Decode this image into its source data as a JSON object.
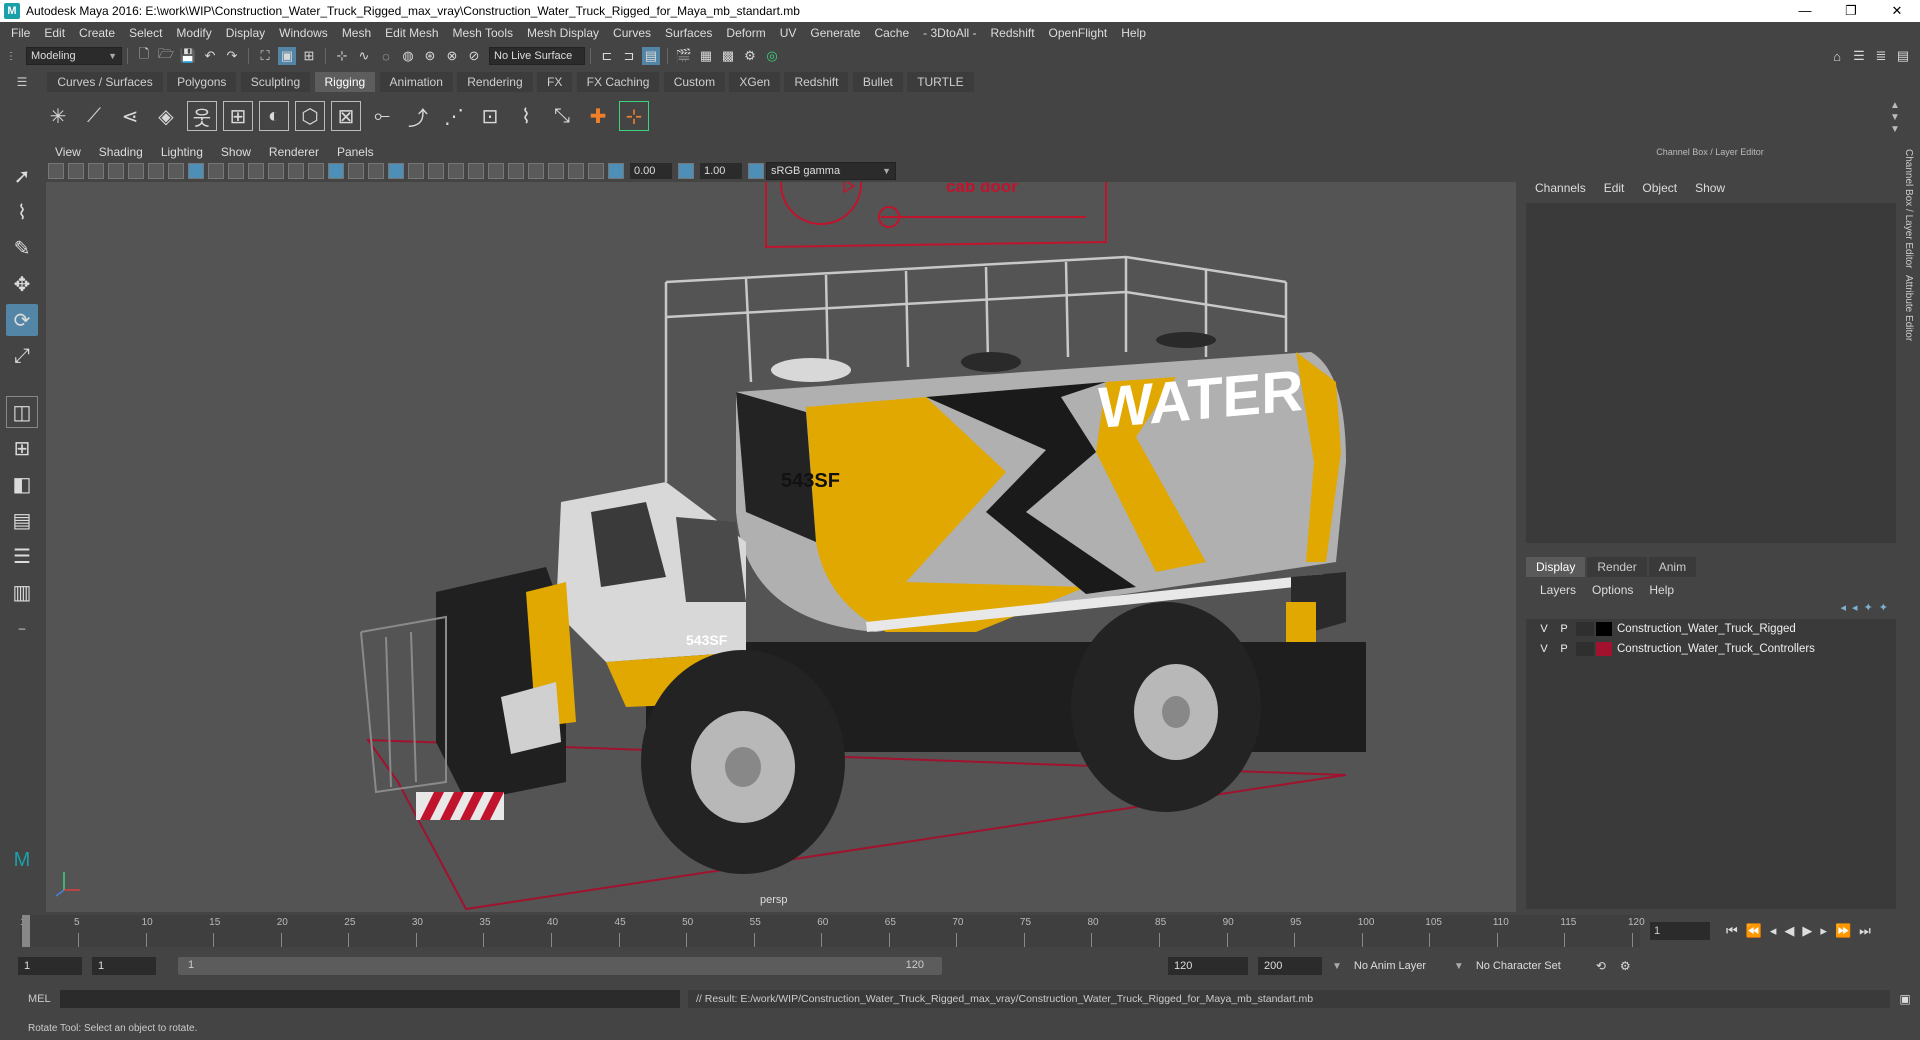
{
  "window": {
    "title": "Autodesk Maya 2016: E:\\work\\WIP\\Construction_Water_Truck_Rigged_max_vray\\Construction_Water_Truck_Rigged_for_Maya_mb_standart.mb",
    "min": "—",
    "max": "❐",
    "close": "✕"
  },
  "menubar": [
    "File",
    "Edit",
    "Create",
    "Select",
    "Modify",
    "Display",
    "Windows",
    "Mesh",
    "Edit Mesh",
    "Mesh Tools",
    "Mesh Display",
    "Curves",
    "Surfaces",
    "Deform",
    "UV",
    "Generate",
    "Cache",
    "- 3DtoAll -",
    "Redshift",
    "OpenFlight",
    "Help"
  ],
  "statusline": {
    "mode": "Modeling",
    "live_surface": "No Live Surface"
  },
  "shelf_tabs": [
    "Curves / Surfaces",
    "Polygons",
    "Sculpting",
    "Rigging",
    "Animation",
    "Rendering",
    "FX",
    "FX Caching",
    "Custom",
    "XGen",
    "Redshift",
    "Bullet",
    "TURTLE"
  ],
  "shelf_active": "Rigging",
  "viewport": {
    "menu": [
      "View",
      "Shading",
      "Lighting",
      "Show",
      "Renderer",
      "Panels"
    ],
    "exposure": "0.00",
    "gamma": "1.00",
    "color_space": "sRGB gamma",
    "camera": "persp",
    "annotation": "cab door",
    "tank_text": "WATER",
    "model_id_1": "543SF",
    "model_id_2": "543SF"
  },
  "right_panel": {
    "title": "Channel Box / Layer Editor",
    "menu": [
      "Channels",
      "Edit",
      "Object",
      "Show"
    ],
    "tabs": [
      "Display",
      "Render",
      "Anim"
    ],
    "active_tab": "Display",
    "sub_menu": [
      "Layers",
      "Options",
      "Help"
    ],
    "layers": [
      {
        "v": "V",
        "p": "P",
        "color": "#000000",
        "name": "Construction_Water_Truck_Rigged"
      },
      {
        "v": "V",
        "p": "P",
        "color": "#a0122e",
        "name": "Construction_Water_Truck_Controllers"
      }
    ],
    "side_tabs": [
      "Channel Box / Layer Editor",
      "Attribute Editor"
    ]
  },
  "timeslider": {
    "ticks": [
      1,
      5,
      10,
      15,
      20,
      25,
      30,
      35,
      40,
      45,
      50,
      55,
      60,
      65,
      70,
      75,
      80,
      85,
      90,
      95,
      100,
      105,
      110,
      115,
      120
    ],
    "current_frame": "1"
  },
  "range": {
    "start": "1",
    "anim_start": "1",
    "slider_start": "1",
    "slider_end": "120",
    "end": "120",
    "anim_end": "200",
    "anim_layer": "No Anim Layer",
    "character_set": "No Character Set"
  },
  "cmdline": {
    "label": "MEL",
    "result": "// Result: E:/work/WIP/Construction_Water_Truck_Rigged_max_vray/Construction_Water_Truck_Rigged_for_Maya_mb_standart.mb"
  },
  "helpline": "Rotate Tool: Select an object to rotate.",
  "colors": {
    "accent": "#5285a6",
    "tank_yellow": "#e0a800",
    "annotation_red": "#c0142d"
  }
}
